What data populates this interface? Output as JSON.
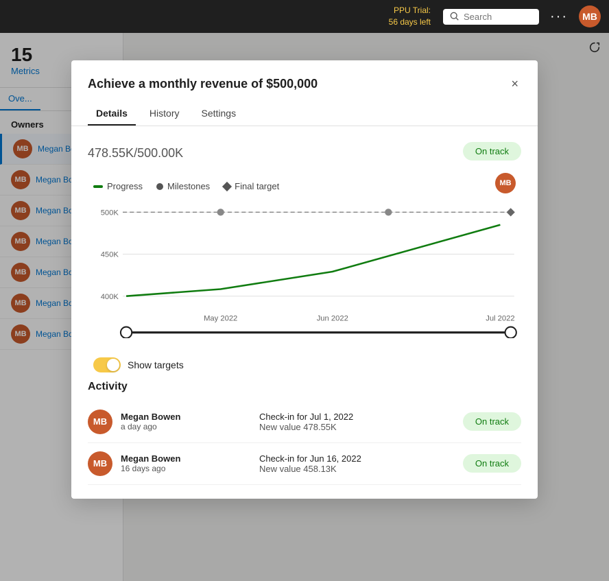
{
  "nav": {
    "trial_label": "PPU Trial:",
    "trial_days": "56 days left",
    "search_placeholder": "Search",
    "search_label": "Search",
    "more_icon": "···"
  },
  "left_panel": {
    "metrics_count": "15",
    "metrics_label": "Metrics",
    "tabs": [
      {
        "label": "Ove..."
      }
    ],
    "owners_title": "Owners",
    "owners": [
      {
        "name": "Megan Bower",
        "initials": "MB",
        "active": true
      },
      {
        "name": "Megan Bower",
        "initials": "MB",
        "active": false
      },
      {
        "name": "Megan Bower",
        "initials": "MB",
        "active": false
      },
      {
        "name": "Megan Bower",
        "initials": "MB",
        "active": false
      },
      {
        "name": "Megan Bower",
        "initials": "MB",
        "active": false
      },
      {
        "name": "Megan Bower",
        "initials": "MB",
        "active": false
      },
      {
        "name": "Megan Bower",
        "initials": "MB",
        "active": false
      }
    ]
  },
  "modal": {
    "title": "Achieve a monthly revenue of $500,000",
    "close_label": "×",
    "tabs": [
      {
        "label": "Details",
        "active": true
      },
      {
        "label": "History",
        "active": false
      },
      {
        "label": "Settings",
        "active": false
      }
    ],
    "value": "478.55K",
    "target": "/500.00K",
    "badge": "On track",
    "chart": {
      "legend": [
        {
          "label": "Progress",
          "type": "line"
        },
        {
          "label": "Milestones",
          "type": "dot"
        },
        {
          "label": "Final target",
          "type": "diamond"
        }
      ],
      "y_labels": [
        "500K",
        "450K",
        "400K"
      ],
      "x_labels": [
        "May 2022",
        "Jun 2022",
        "Jul 2022"
      ]
    },
    "show_targets_label": "Show targets",
    "activity_title": "Activity",
    "activity_items": [
      {
        "name": "Megan Bowen",
        "time": "a day ago",
        "detail": "Check-in for Jul 1, 2022",
        "subdetail": "New value 478.55K",
        "badge": "On track",
        "initials": "MB"
      },
      {
        "name": "Megan Bowen",
        "time": "16 days ago",
        "detail": "Check-in for Jun 16, 2022",
        "subdetail": "New value 458.13K",
        "badge": "On track",
        "initials": "MB"
      }
    ]
  }
}
